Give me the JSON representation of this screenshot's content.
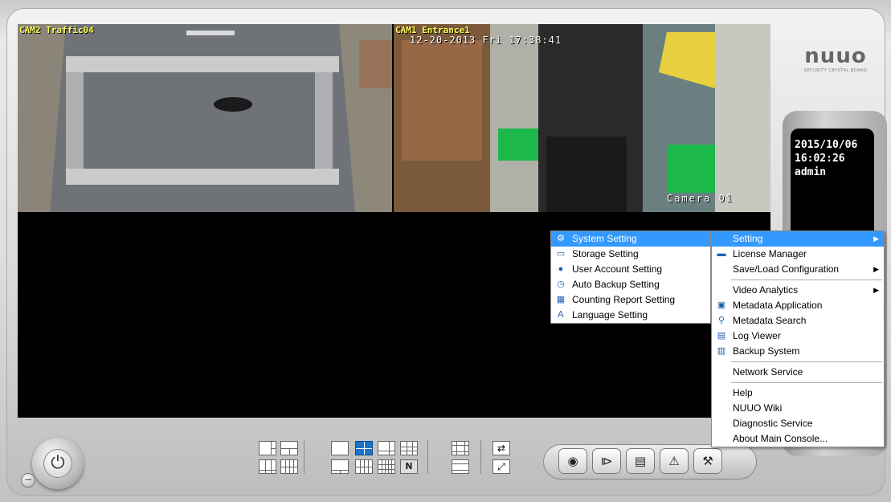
{
  "cameras": [
    {
      "label": "CAM2 Traffic04"
    },
    {
      "label": "CAM1 Entrance1",
      "timestamp": "12-20-2013 Fri 17:38:41",
      "osd": "Camera 01"
    }
  ],
  "logo": {
    "text": "nuuo",
    "subtitle": "SECURITY CRYSTAL BOARD"
  },
  "info": {
    "date": "2015/10/06",
    "time": "16:02:26",
    "user": "admin"
  },
  "submenu": {
    "items": [
      {
        "label": "System Setting",
        "icon": "gear-icon",
        "highlighted": true
      },
      {
        "label": "Storage Setting",
        "icon": "storage-icon"
      },
      {
        "label": "User Account Setting",
        "icon": "user-icon"
      },
      {
        "label": "Auto Backup Setting",
        "icon": "backup-icon"
      },
      {
        "label": "Counting Report Setting",
        "icon": "report-icon"
      },
      {
        "label": "Language Setting",
        "icon": "language-icon"
      }
    ]
  },
  "mainmenu": {
    "items": [
      {
        "label": "Setting",
        "highlighted": true,
        "submenu": true
      },
      {
        "label": "License Manager",
        "icon": "license-icon"
      },
      {
        "label": "Save/Load Configuration",
        "submenu": true
      },
      {
        "separator": true
      },
      {
        "label": "Video Analytics",
        "submenu": true
      },
      {
        "label": "Metadata Application",
        "icon": "metadata-app-icon"
      },
      {
        "label": "Metadata Search",
        "icon": "metadata-search-icon"
      },
      {
        "label": "Log Viewer",
        "icon": "log-icon"
      },
      {
        "label": "Backup System",
        "icon": "backup-system-icon"
      },
      {
        "separator": true
      },
      {
        "label": "Network Service"
      },
      {
        "separator": true
      },
      {
        "label": "Help"
      },
      {
        "label": "NUUO Wiki"
      },
      {
        "label": "Diagnostic Service"
      },
      {
        "label": "About Main Console..."
      }
    ]
  },
  "controls": {
    "power": "power-icon",
    "buttons": [
      "record-icon",
      "playback-icon",
      "schedule-icon",
      "alert-icon",
      "tools-icon"
    ],
    "layout_letter": "N"
  },
  "colors": {
    "menu_highlight": "#3399ff",
    "layout_selected": "#1d73c8",
    "cam_label": "#ffff55"
  }
}
